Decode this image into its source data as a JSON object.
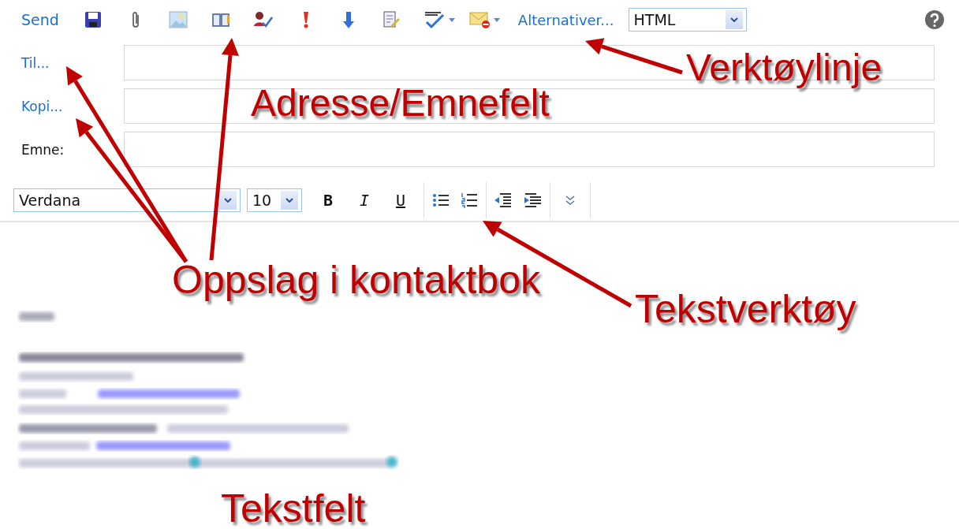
{
  "toolbar": {
    "send": "Send",
    "options": "Alternativer...",
    "format": "HTML"
  },
  "address_fields": [
    {
      "label": "Til...",
      "kind": "link"
    },
    {
      "label": "Kopi...",
      "kind": "link"
    },
    {
      "label": "Emne:",
      "kind": "plain"
    }
  ],
  "format_bar": {
    "font": "Verdana",
    "size": "10",
    "buttons": [
      {
        "label": "B",
        "kind": "bold"
      },
      {
        "label": "I",
        "kind": "italic"
      },
      {
        "label": "U",
        "kind": "underline"
      }
    ]
  },
  "annotations": [
    {
      "text": "Verktøylinje"
    },
    {
      "text": "Adresse/Emnefelt"
    },
    {
      "text": "Oppslag i kontaktbok"
    },
    {
      "text": "Tekstverktøy"
    },
    {
      "text": "Tekstfelt"
    }
  ]
}
